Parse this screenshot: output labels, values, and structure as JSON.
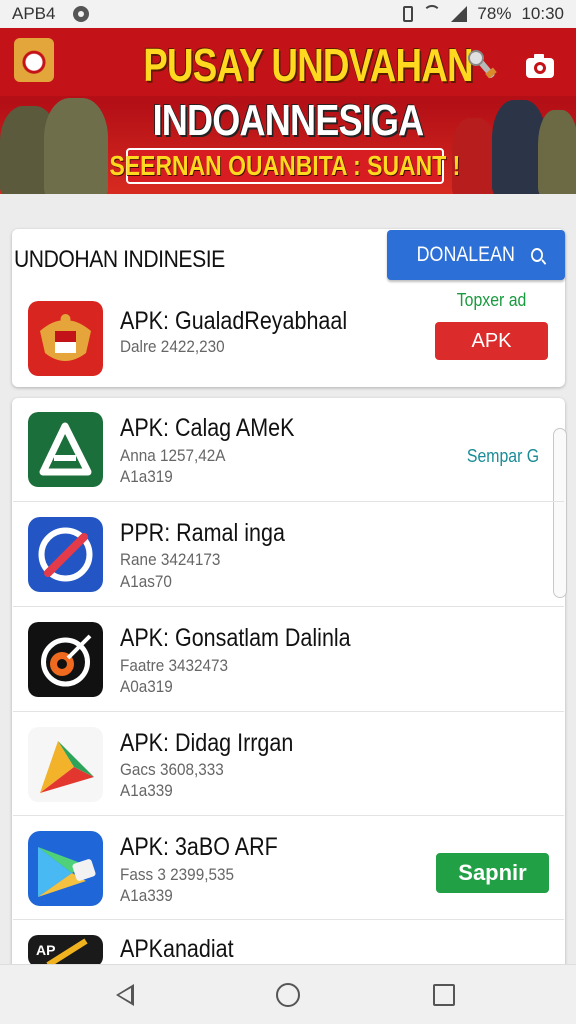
{
  "status_bar": {
    "left_text": "APB4",
    "battery": "78%",
    "time": "10:30"
  },
  "banner": {
    "title_line1": "PUSAY UNDVAHAN",
    "title_line2": "INDOANNESIGA",
    "subtitle": "SEERNAN OUANBITA : SUANT !"
  },
  "top_card": {
    "heading": "UNDOHAN INDINESIE",
    "download_button": "DONALEAN",
    "featured": {
      "name": "APK: GualadReyabhaal",
      "meta": "Dalre 2422,230",
      "badge": "Topxer ad",
      "button": "APK"
    }
  },
  "apps": [
    {
      "name": "APK: Calag AMeK",
      "meta1": "Anna 1257,42A",
      "meta2": "A1a319",
      "side_label": "Sempar G"
    },
    {
      "name": "PPR: Ramal inga",
      "meta1": "Rane 3424173",
      "meta2": "A1as70"
    },
    {
      "name": "APK: Gonsatlam Dalinla",
      "meta1": "Faatre 3432473",
      "meta2": "A0a319"
    },
    {
      "name": "APK: Didag Irrgan",
      "meta1": "Gacs 3608,333",
      "meta2": "A1a339"
    },
    {
      "name": "APK: 3aBO ARF",
      "meta1": "Fass 3 2399,535",
      "meta2": "A1a339",
      "button": "Sapnir"
    },
    {
      "name": "APKanadiat",
      "meta1": "",
      "meta2": ""
    }
  ],
  "colors": {
    "banner_red": "#c41219",
    "banner_yellow": "#ffd91f",
    "download_blue": "#2c6fd6",
    "apk_red": "#dc2b2b",
    "badge_green": "#1a9a3f",
    "side_teal": "#1a8c97",
    "install_green": "#22a045"
  },
  "nav": {
    "back": "back-icon",
    "home": "home-icon",
    "recents": "recents-icon"
  }
}
